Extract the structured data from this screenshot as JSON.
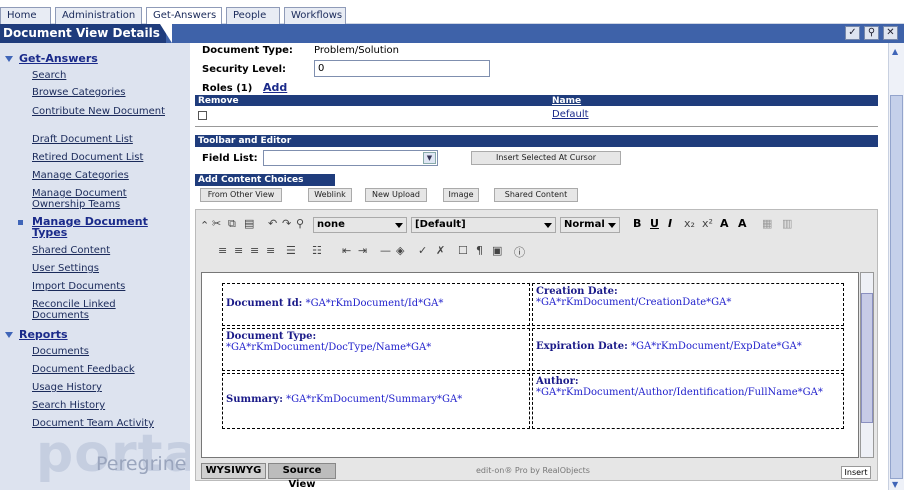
{
  "nav_tabs": [
    "Home",
    "Administration",
    "Get-Answers",
    "People",
    "Workflows"
  ],
  "header": {
    "title": "Document View Details",
    "icons": [
      "check-icon",
      "search-icon",
      "close-icon"
    ]
  },
  "sidebar": {
    "section1": "Get-Answers",
    "items1": [
      "Search",
      "Browse Categories",
      "Contribute New Document",
      "Draft Document List",
      "Retired Document List",
      "Manage Categories",
      "Manage Document Ownership Teams",
      "Manage Document Types",
      "Shared Content",
      "User Settings",
      "Import Documents",
      "Reconcile Linked Documents"
    ],
    "section2": "Reports",
    "items2": [
      "Documents",
      "Document Feedback",
      "Usage History",
      "Search History",
      "Document Team Activity"
    ],
    "watermark": "portal",
    "brand": "Peregrine"
  },
  "form": {
    "doc_type_label": "Document Type:",
    "doc_type_value": "Problem/Solution",
    "security_label": "Security Level:",
    "security_value": "0",
    "roles_label": "Roles (1)",
    "roles_add": "Add",
    "roles_table": {
      "headers": [
        "Remove",
        "Name"
      ],
      "rows": [
        {
          "name": "Default"
        }
      ]
    },
    "toolbar_editor_title": "Toolbar and Editor",
    "field_list_label": "Field List:",
    "insert_button": "Insert Selected At Cursor",
    "add_content_title": "Add Content Choices",
    "content_buttons": [
      "From Other View",
      "Weblink",
      "New Upload",
      "Image",
      "Shared Content"
    ]
  },
  "editor": {
    "style_select": "none",
    "font_select": "[Default]",
    "size_select": "Normal",
    "cells": [
      {
        "label": "Document Id:",
        "value": "*GA*rKmDocument/Id*GA*"
      },
      {
        "label": "Creation Date:",
        "value": "*GA*rKmDocument/CreationDate*GA*"
      },
      {
        "label": "Document Type:",
        "value": "*GA*rKmDocument/DocType/Name*GA*"
      },
      {
        "label": "Expiration Date:",
        "value": "*GA*rKmDocument/ExpDate*GA*"
      },
      {
        "label": "Summary:",
        "value": "*GA*rKmDocument/Summary*GA*"
      },
      {
        "label": "Author:",
        "value": "*GA*rKmDocument/Author/Identification/FullName*GA*"
      }
    ],
    "bottom_tabs": [
      "WYSIWYG",
      "Source View"
    ],
    "footer_text": "edit-on® Pro by RealObjects",
    "insert_mode": "Insert"
  }
}
